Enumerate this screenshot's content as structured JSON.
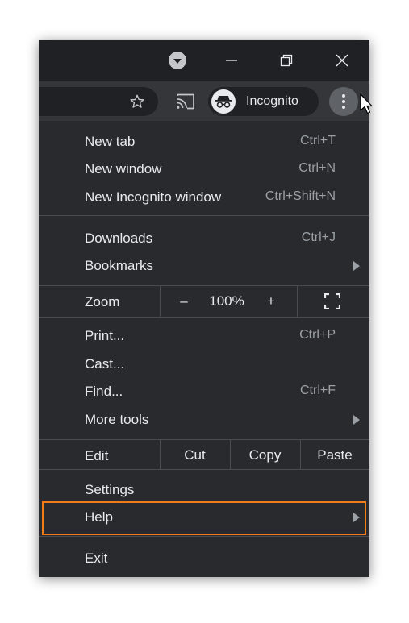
{
  "titlebar": {
    "icons": [
      "tab-search-icon",
      "minimize-icon",
      "restore-icon",
      "close-icon"
    ]
  },
  "toolbar": {
    "incognito_label": "Incognito",
    "icons": [
      "star-icon",
      "cast-icon",
      "incognito-icon",
      "kebab-menu-icon"
    ]
  },
  "menu": {
    "group1": [
      {
        "label": "New tab",
        "shortcut": "Ctrl+T"
      },
      {
        "label": "New window",
        "shortcut": "Ctrl+N"
      },
      {
        "label": "New Incognito window",
        "shortcut": "Ctrl+Shift+N"
      }
    ],
    "group2": [
      {
        "label": "Downloads",
        "shortcut": "Ctrl+J"
      },
      {
        "label": "Bookmarks",
        "shortcut": ""
      }
    ],
    "zoom": {
      "label": "Zoom",
      "minus": "–",
      "value": "100%",
      "plus": "+"
    },
    "group3": [
      {
        "label": "Print...",
        "shortcut": "Ctrl+P"
      },
      {
        "label": "Cast...",
        "shortcut": ""
      },
      {
        "label": "Find...",
        "shortcut": "Ctrl+F"
      },
      {
        "label": "More tools",
        "shortcut": ""
      }
    ],
    "edit": {
      "label": "Edit",
      "cut": "Cut",
      "copy": "Copy",
      "paste": "Paste"
    },
    "group4": [
      {
        "label": "Settings"
      },
      {
        "label": "Help"
      }
    ],
    "exit": {
      "label": "Exit"
    }
  },
  "colors": {
    "menu_bg": "#292a2d",
    "titlebar_bg": "#202124",
    "toolbar_bg": "#35363a",
    "text": "#e8eaed",
    "shortcut_text": "#9aa0a6",
    "highlight": "#f27c1a"
  }
}
